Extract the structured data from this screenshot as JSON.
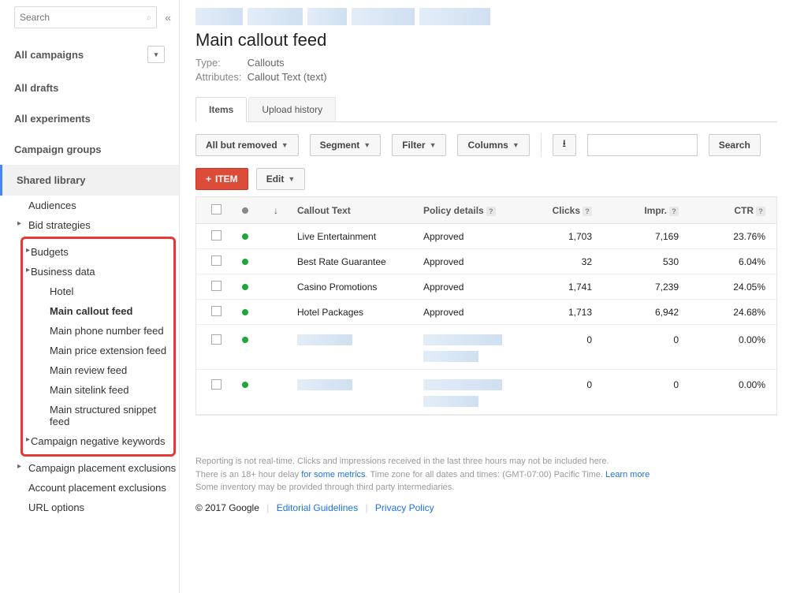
{
  "sidebar": {
    "search_placeholder": "Search",
    "items": [
      {
        "label": "All campaigns",
        "caret": true
      },
      {
        "label": "All drafts"
      },
      {
        "label": "All experiments"
      },
      {
        "label": "Campaign groups"
      }
    ],
    "shared_library": "Shared library",
    "tree": {
      "audiences": "Audiences",
      "bid_strategies": "Bid strategies",
      "budgets": "Budgets",
      "business_data": "Business data",
      "business_children": [
        "Hotel",
        "Main callout feed",
        "Main phone number feed",
        "Main price extension feed",
        "Main review feed",
        "Main sitelink feed",
        "Main structured snippet feed"
      ],
      "campaign_negative": "Campaign negative keywords",
      "campaign_placement": "Campaign placement exclusions",
      "account_placement": "Account placement exclusions",
      "url_options": "URL options"
    }
  },
  "main": {
    "title": "Main callout feed",
    "type_label": "Type:",
    "type_value": "Callouts",
    "attr_label": "Attributes:",
    "attr_value": "Callout Text (text)",
    "tabs": {
      "items": "Items",
      "upload": "Upload history"
    },
    "toolbar": {
      "all_but_removed": "All but removed",
      "segment": "Segment",
      "filter": "Filter",
      "columns": "Columns",
      "search": "Search",
      "item": "ITEM",
      "edit": "Edit"
    },
    "headers": {
      "callout": "Callout Text",
      "policy": "Policy details",
      "clicks": "Clicks",
      "impr": "Impr.",
      "ctr": "CTR"
    },
    "rows": [
      {
        "text": "Live Entertainment",
        "policy": "Approved",
        "clicks": "1,703",
        "impr": "7,169",
        "ctr": "23.76%",
        "redacted": false
      },
      {
        "text": "Best Rate Guarantee",
        "policy": "Approved",
        "clicks": "32",
        "impr": "530",
        "ctr": "6.04%",
        "redacted": false
      },
      {
        "text": "Casino Promotions",
        "policy": "Approved",
        "clicks": "1,741",
        "impr": "7,239",
        "ctr": "24.05%",
        "redacted": false
      },
      {
        "text": "Hotel Packages",
        "policy": "Approved",
        "clicks": "1,713",
        "impr": "6,942",
        "ctr": "24.68%",
        "redacted": false
      },
      {
        "text": "",
        "policy": "",
        "clicks": "0",
        "impr": "0",
        "ctr": "0.00%",
        "redacted": true
      },
      {
        "text": "",
        "policy": "",
        "clicks": "0",
        "impr": "0",
        "ctr": "0.00%",
        "redacted": true
      }
    ]
  },
  "footer": {
    "l1": "Reporting is not real-time. Clicks and impressions received in the last three hours may not be included here.",
    "l2a": "There is an 18+ hour delay ",
    "l2link": "for some metrics",
    "l2b": ". Time zone for all dates and times: (GMT-07:00) Pacific Time. ",
    "learn": "Learn more",
    "l3": "Some inventory may be provided through third party intermediaries.",
    "copyright": "© 2017 Google",
    "editorial": "Editorial Guidelines",
    "privacy": "Privacy Policy"
  }
}
